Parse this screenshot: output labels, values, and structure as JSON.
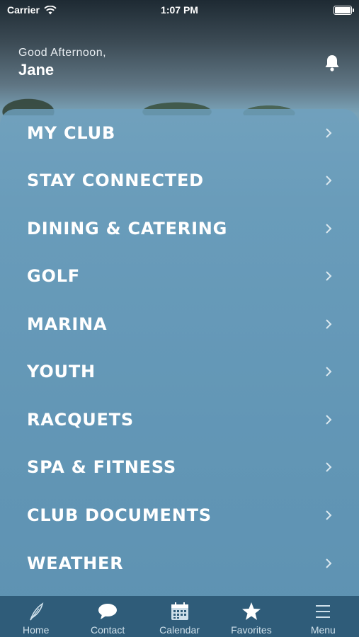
{
  "status_bar": {
    "carrier": "Carrier",
    "time": "1:07 PM"
  },
  "header": {
    "greeting": "Good Afternoon,",
    "name": "Jane",
    "notification_icon": "bell-icon"
  },
  "menu": {
    "items": [
      {
        "label": "MY CLUB"
      },
      {
        "label": "STAY CONNECTED"
      },
      {
        "label": "DINING & CATERING"
      },
      {
        "label": "GOLF"
      },
      {
        "label": "MARINA"
      },
      {
        "label": "YOUTH"
      },
      {
        "label": "RACQUETS"
      },
      {
        "label": "SPA & FITNESS"
      },
      {
        "label": "CLUB DOCUMENTS"
      },
      {
        "label": "WEATHER"
      }
    ],
    "chevron_icon": "chevron-right-icon"
  },
  "tabbar": {
    "tabs": [
      {
        "label": "Home",
        "icon": "feather-icon"
      },
      {
        "label": "Contact",
        "icon": "chat-bubble-icon"
      },
      {
        "label": "Calendar",
        "icon": "calendar-icon"
      },
      {
        "label": "Favorites",
        "icon": "star-icon"
      },
      {
        "label": "Menu",
        "icon": "hamburger-icon"
      }
    ]
  },
  "colors": {
    "tabbar_bg": "#2f5c79",
    "panel": "#6aa0be",
    "text": "#ffffff"
  }
}
